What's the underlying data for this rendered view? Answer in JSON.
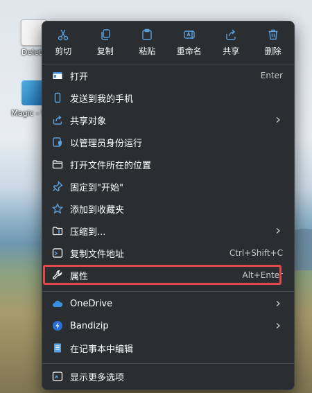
{
  "desktop": {
    "icons": [
      {
        "label": "Delete",
        "name": "delete-shortcut"
      },
      {
        "label": "Magic - 快捷",
        "name": "magic-shortcut"
      }
    ]
  },
  "toolbar": [
    {
      "label": "剪切",
      "icon": "scissors-icon"
    },
    {
      "label": "复制",
      "icon": "copy-icon"
    },
    {
      "label": "粘贴",
      "icon": "paste-icon"
    },
    {
      "label": "重命名",
      "icon": "rename-icon"
    },
    {
      "label": "共享",
      "icon": "share-icon"
    },
    {
      "label": "删除",
      "icon": "trash-icon"
    }
  ],
  "items": [
    {
      "label": "打开",
      "shortcut": "Enter",
      "icon": "open-app-icon"
    },
    {
      "label": "发送到我的手机",
      "shortcut": "",
      "icon": "phone-icon"
    },
    {
      "label": "共享对象",
      "shortcut": "",
      "icon": "share-icon",
      "submenu": true
    },
    {
      "label": "以管理员身份运行",
      "shortcut": "",
      "icon": "shield-icon"
    },
    {
      "label": "打开文件所在的位置",
      "shortcut": "",
      "icon": "folder-icon"
    },
    {
      "label": "固定到\"开始\"",
      "shortcut": "",
      "icon": "pin-icon"
    },
    {
      "label": "添加到收藏夹",
      "shortcut": "",
      "icon": "star-icon"
    },
    {
      "label": "压缩到...",
      "shortcut": "",
      "icon": "zip-folder-icon",
      "submenu": true
    },
    {
      "label": "复制文件地址",
      "shortcut": "Ctrl+Shift+C",
      "icon": "copy-path-icon"
    },
    {
      "label": "属性",
      "shortcut": "Alt+Enter",
      "icon": "wrench-icon"
    },
    {
      "label": "OneDrive",
      "shortcut": "",
      "icon": "cloud-icon",
      "submenu": true
    },
    {
      "label": "Bandizip",
      "shortcut": "",
      "icon": "bandizip-icon",
      "submenu": true
    },
    {
      "label": "在记事本中编辑",
      "shortcut": "",
      "icon": "notepad-icon"
    },
    {
      "label": "显示更多选项",
      "shortcut": "",
      "icon": "more-options-icon"
    }
  ],
  "colors": {
    "accent": "#5aa0e0",
    "highlight_border": "#e3484a",
    "menu_bg": "#2b2e31"
  }
}
